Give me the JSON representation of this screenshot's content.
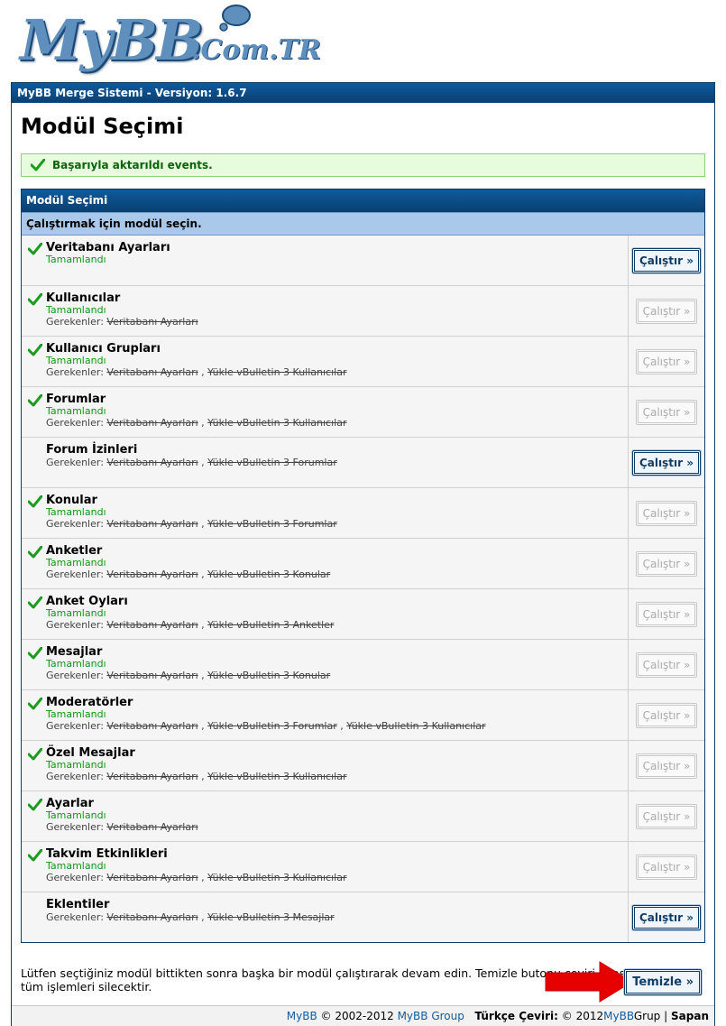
{
  "logo": {
    "main": "MyBB",
    "sub": ".Com.TR"
  },
  "header": {
    "title": "MyBB Merge Sistemi - Versiyon: 1.6.7"
  },
  "page": {
    "title": "Modül Seçimi",
    "success_message": "Başarıyla aktarıldı events."
  },
  "table": {
    "heading": "Modül Seçimi",
    "subheading": "Çalıştırmak için modül seçin.",
    "requires_label": "Gerekenler:",
    "rows": [
      {
        "name": "Veritabanı Ayarları",
        "done": true,
        "status": "Tamamlandı",
        "deps": [],
        "button": "Çalıştır »",
        "enabled": true
      },
      {
        "name": "Kullanıcılar",
        "done": true,
        "status": "Tamamlandı",
        "deps": [
          "Veritabanı Ayarları"
        ],
        "button": "Çalıştır »",
        "enabled": false
      },
      {
        "name": "Kullanıcı Grupları",
        "done": true,
        "status": "Tamamlandı",
        "deps": [
          "Veritabanı Ayarları",
          "Yükle vBulletin 3 Kullanıcılar"
        ],
        "button": "Çalıştır »",
        "enabled": false
      },
      {
        "name": "Forumlar",
        "done": true,
        "status": "Tamamlandı",
        "deps": [
          "Veritabanı Ayarları",
          "Yükle vBulletin 3 Kullanıcılar"
        ],
        "button": "Çalıştır »",
        "enabled": false
      },
      {
        "name": "Forum İzinleri",
        "done": false,
        "status": "",
        "deps": [
          "Veritabanı Ayarları",
          "Yükle vBulletin 3 Forumlar"
        ],
        "button": "Çalıştır »",
        "enabled": true
      },
      {
        "name": "Konular",
        "done": true,
        "status": "Tamamlandı",
        "deps": [
          "Veritabanı Ayarları",
          "Yükle vBulletin 3 Forumlar"
        ],
        "button": "Çalıştır »",
        "enabled": false
      },
      {
        "name": "Anketler",
        "done": true,
        "status": "Tamamlandı",
        "deps": [
          "Veritabanı Ayarları",
          "Yükle vBulletin 3 Konular"
        ],
        "button": "Çalıştır »",
        "enabled": false
      },
      {
        "name": "Anket Oyları",
        "done": true,
        "status": "Tamamlandı",
        "deps": [
          "Veritabanı Ayarları",
          "Yükle vBulletin 3 Anketler"
        ],
        "button": "Çalıştır »",
        "enabled": false
      },
      {
        "name": "Mesajlar",
        "done": true,
        "status": "Tamamlandı",
        "deps": [
          "Veritabanı Ayarları",
          "Yükle vBulletin 3 Konular"
        ],
        "button": "Çalıştır »",
        "enabled": false
      },
      {
        "name": "Moderatörler",
        "done": true,
        "status": "Tamamlandı",
        "deps": [
          "Veritabanı Ayarları",
          "Yükle vBulletin 3 Forumlar",
          "Yükle vBulletin 3 Kullanıcılar"
        ],
        "button": "Çalıştır »",
        "enabled": false
      },
      {
        "name": "Özel Mesajlar",
        "done": true,
        "status": "Tamamlandı",
        "deps": [
          "Veritabanı Ayarları",
          "Yükle vBulletin 3 Kullanıcılar"
        ],
        "button": "Çalıştır »",
        "enabled": false
      },
      {
        "name": "Ayarlar",
        "done": true,
        "status": "Tamamlandı",
        "deps": [
          "Veritabanı Ayarları"
        ],
        "button": "Çalıştır »",
        "enabled": false
      },
      {
        "name": "Takvim Etkinlikleri",
        "done": true,
        "status": "Tamamlandı",
        "deps": [
          "Veritabanı Ayarları",
          "Yükle vBulletin 3 Kullanıcılar"
        ],
        "button": "Çalıştır »",
        "enabled": false
      },
      {
        "name": "Eklentiler",
        "done": false,
        "status": "",
        "deps": [
          "Veritabanı Ayarları",
          "Yükle vBulletin 3 Mesajlar"
        ],
        "button": "Çalıştır »",
        "enabled": true
      }
    ]
  },
  "help_text": "Lütfen seçtiğiniz modül bittikten sonra başka bir modül çalıştırarak devam edin. Temizle butonu çeviri sırasında yapılan tüm işlemleri silecektir.",
  "clean_button": "Temizle »",
  "footer": {
    "link1": "MyBB",
    "copy1": "© 2002-2012",
    "link2": "MyBB Group",
    "trans_label": "Türkçe Çeviri:",
    "copy2": "© 2012",
    "link3": "MyBB",
    "grup": "Grup",
    "sep": "|",
    "author": "Sapan"
  },
  "colors": {
    "header_blue": "#0f5b9e",
    "subheader_blue": "#a9c8ea",
    "success_bg": "#e6fcdc",
    "success_text": "#09630b",
    "status_green": "#12941a",
    "arrow_red": "#e60000"
  }
}
